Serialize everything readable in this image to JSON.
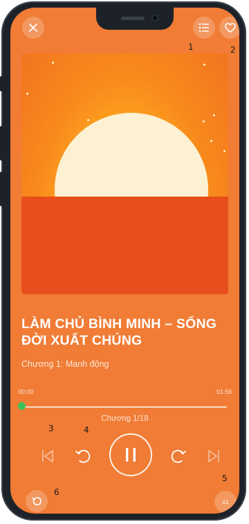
{
  "header": {
    "close_icon": "close-icon",
    "playlist_icon": "list-icon",
    "favorite_icon": "heart-icon"
  },
  "annotations": [
    "1",
    "2",
    "3",
    "4",
    "5",
    "6"
  ],
  "book": {
    "title_line1": "LÀM CHỦ BÌNH MINH – SỐNG",
    "title_line2": "ĐỜI XUẤT CHÚNG",
    "chapter": "Chương 1: Manh động"
  },
  "progress": {
    "current": "00:00",
    "total": "01:56",
    "fraction": 0.0,
    "chapter_count": "Chương 1/18"
  },
  "controls": {
    "previous_icon": "skip-previous-icon",
    "rewind_icon": "rotate-left-icon",
    "play_pause_icon": "pause-icon",
    "forward_icon": "rotate-right-icon",
    "next_icon": "skip-next-icon",
    "timer_icon": "timer-icon",
    "speed": "x1"
  },
  "colors": {
    "background": "#f07c35",
    "progress_knob": "#39c45a",
    "sun": "#fcf1d2",
    "sea": "#e84e1b"
  }
}
